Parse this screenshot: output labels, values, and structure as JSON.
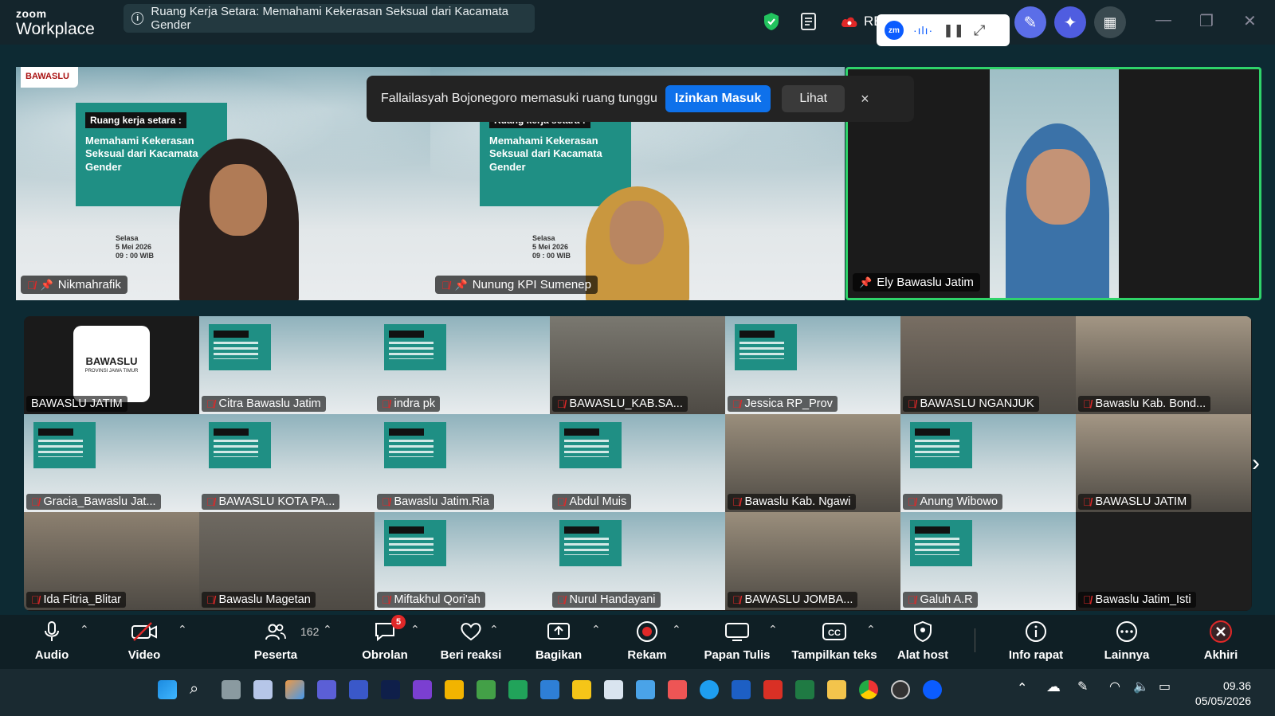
{
  "app": {
    "brand_small": "zoom",
    "brand_big": "Workplace"
  },
  "meeting": {
    "title": "Ruang Kerja Setara: Memahami Kekerasan Seksual dari Kacamata Gender"
  },
  "recording_label": "RE",
  "recording_pill": {
    "badge": "zm"
  },
  "notification": {
    "message": "Fallailasyah Bojonegoro memasuki ruang tunggu",
    "allow_label": "Izinkan Masuk",
    "view_label": "Lihat",
    "close": "×"
  },
  "slide": {
    "heading": "Ruang kerja setara :",
    "subheading": "Memahami Kekerasan Seksual dari Kacamata Gender",
    "day": "Selasa",
    "date": "5 Mei 2026",
    "time": "09 : 00 WIB",
    "brand": "BAWASLU"
  },
  "speakers": [
    {
      "name": "Nikmahrafik",
      "muted": true,
      "pinned": true
    },
    {
      "name": "Nunung KPI Sumenep",
      "muted": true,
      "pinned": true
    },
    {
      "name": "Ely Bawaslu Jatim",
      "muted": false,
      "pinned": true
    }
  ],
  "bawaslu_logo": {
    "title": "BAWASLU",
    "sub": "PROVINSI JAWA TIMUR"
  },
  "grid": [
    {
      "name": "BAWASLU JATIM",
      "muted": false,
      "kind": "logo"
    },
    {
      "name": "Citra Bawaslu Jatim",
      "muted": true,
      "kind": "slide"
    },
    {
      "name": "indra pk",
      "muted": true,
      "kind": "slide"
    },
    {
      "name": "BAWASLU_KAB.SA...",
      "muted": true,
      "kind": "room"
    },
    {
      "name": "Jessica RP_Prov",
      "muted": true,
      "kind": "slide"
    },
    {
      "name": "BAWASLU NGANJUK",
      "muted": true,
      "kind": "room"
    },
    {
      "name": "Bawaslu Kab. Bond...",
      "muted": true,
      "kind": "room"
    },
    {
      "name": "Gracia_Bawaslu Jat...",
      "muted": true,
      "kind": "slide"
    },
    {
      "name": "BAWASLU KOTA PA...",
      "muted": true,
      "kind": "slide"
    },
    {
      "name": "Bawaslu Jatim.Ria",
      "muted": true,
      "kind": "slide"
    },
    {
      "name": "Abdul Muis",
      "muted": true,
      "kind": "slide"
    },
    {
      "name": "Bawaslu Kab. Ngawi",
      "muted": true,
      "kind": "room"
    },
    {
      "name": "Anung Wibowo",
      "muted": true,
      "kind": "slide"
    },
    {
      "name": "BAWASLU JATIM",
      "muted": true,
      "kind": "room"
    },
    {
      "name": "Ida Fitria_Blitar",
      "muted": true,
      "kind": "room"
    },
    {
      "name": "Bawaslu Magetan",
      "muted": true,
      "kind": "room"
    },
    {
      "name": "Miftakhul Qori'ah",
      "muted": true,
      "kind": "slide"
    },
    {
      "name": "Nurul Handayani",
      "muted": true,
      "kind": "slide"
    },
    {
      "name": "BAWASLU JOMBA...",
      "muted": true,
      "kind": "room"
    },
    {
      "name": "Galuh A.R",
      "muted": true,
      "kind": "slide"
    },
    {
      "name": "Bawaslu Jatim_Isti",
      "muted": true,
      "kind": "dark"
    }
  ],
  "toolbar": {
    "audio": "Audio",
    "video": "Video",
    "participants": "Peserta",
    "participants_count": "162",
    "chat": "Obrolan",
    "chat_badge": "5",
    "react": "Beri reaksi",
    "share": "Bagikan",
    "record": "Rekam",
    "whiteboard": "Papan Tulis",
    "captions": "Tampilkan teks",
    "host_tools": "Alat host",
    "info": "Info rapat",
    "more": "Lainnya",
    "end": "Akhiri"
  },
  "taskbar": {
    "time": "09.36",
    "date": "05/05/2026"
  },
  "colors": {
    "active_speaker": "#2fd36a",
    "accent": "#0e71eb",
    "muted": "#e02828",
    "end": "#e02828"
  }
}
